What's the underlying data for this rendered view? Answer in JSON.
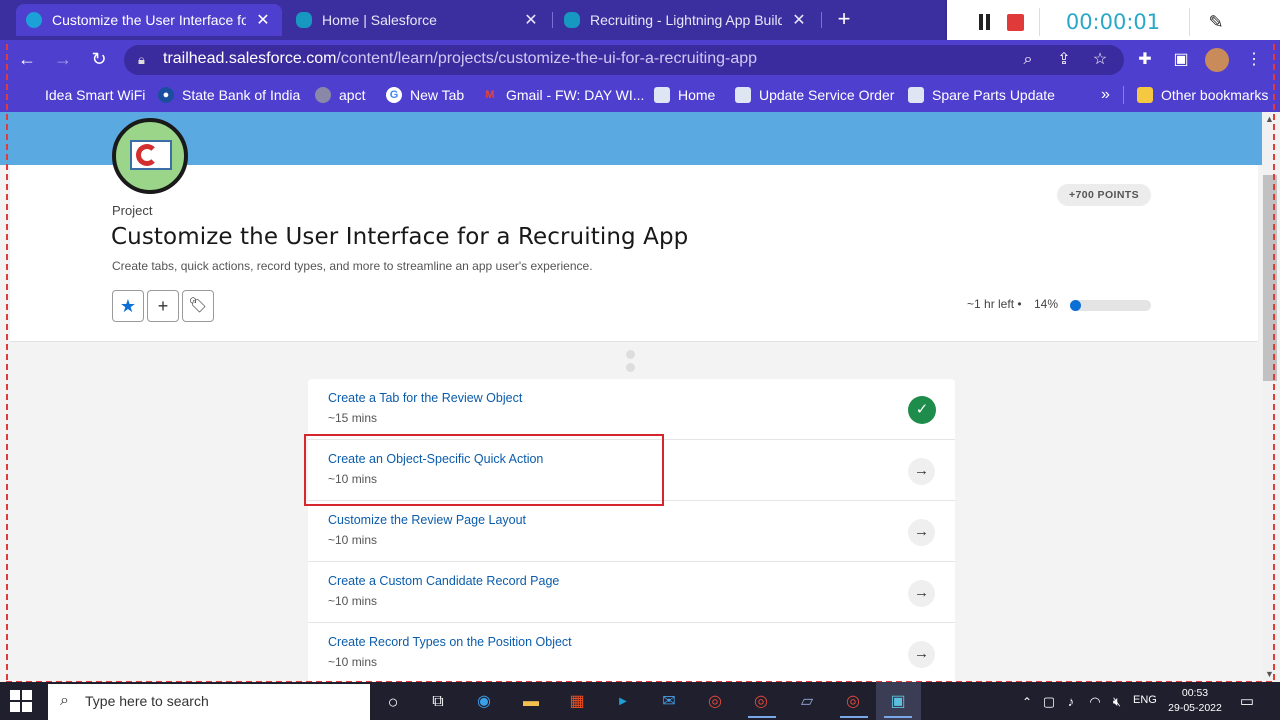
{
  "tabs": [
    {
      "title": "Customize the User Interface for",
      "favicon_color": "#1ba0d8",
      "active": true
    },
    {
      "title": "Home | Salesforce",
      "favicon_color": "#1798c1",
      "active": false
    },
    {
      "title": "Recruiting - Lightning App Builde",
      "favicon_color": "#1798c1",
      "active": false
    }
  ],
  "recorder": {
    "time": "00:00:01"
  },
  "address": {
    "host": "trailhead.salesforce.com",
    "path": "/content/learn/projects/customize-the-ui-for-a-recruiting-app"
  },
  "bookmarks": [
    {
      "label": "Idea Smart WiFi"
    },
    {
      "label": "State Bank of India"
    },
    {
      "label": "apct"
    },
    {
      "label": "New Tab"
    },
    {
      "label": "Gmail - FW: DAY WI..."
    },
    {
      "label": "Home"
    },
    {
      "label": "Update Service Order"
    },
    {
      "label": "Spare Parts Update"
    }
  ],
  "bookmarks_more": "»",
  "other_bookmarks": "Other bookmarks",
  "project": {
    "label": "Project",
    "title": "Customize the User Interface for a Recruiting App",
    "description": "Create tabs, quick actions, record types, and more to streamline an app user's experience.",
    "points": "+700 POINTS",
    "time_left": "~1 hr left  •",
    "percent": "14%",
    "progress": 0.14
  },
  "steps": [
    {
      "title": "Create a Tab for the Review Object",
      "duration": "~15 mins",
      "completed": true
    },
    {
      "title": "Create an Object-Specific Quick Action",
      "duration": "~10 mins",
      "completed": false
    },
    {
      "title": "Customize the Review Page Layout",
      "duration": "~10 mins",
      "completed": false
    },
    {
      "title": "Create a Custom Candidate Record Page",
      "duration": "~10 mins",
      "completed": false
    },
    {
      "title": "Create Record Types on the Position Object",
      "duration": "~10 mins",
      "completed": false
    }
  ],
  "taskbar": {
    "search_placeholder": "Type here to search",
    "lang": "ENG",
    "time": "00:53",
    "date": "29-05-2022"
  },
  "colors": {
    "brand_purple": "#4f3fcf",
    "link_blue": "#0b5cab",
    "success_green": "#1e8c4a",
    "highlight_red": "#d4262c"
  }
}
